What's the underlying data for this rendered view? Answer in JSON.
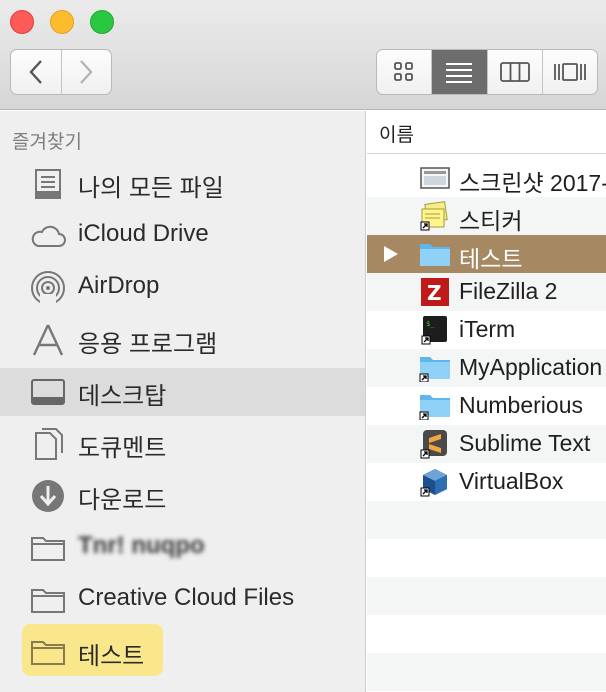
{
  "window": {
    "colors": {
      "close": "#fc5b57",
      "minimize": "#fdbc2e",
      "maximize": "#2ac840",
      "selection": "#a68963",
      "highlight": "#fce57a"
    }
  },
  "toolbar": {
    "back_icon": "chevron-left-icon",
    "forward_icon": "chevron-right-icon",
    "views": [
      "icon-view-icon",
      "list-view-icon",
      "column-view-icon",
      "cover-flow-icon"
    ],
    "active_view": "list-view-icon"
  },
  "sidebar": {
    "heading": "즐겨찾기",
    "items": [
      {
        "label": "나의 모든 파일",
        "icon": "all-files-icon"
      },
      {
        "label": "iCloud Drive",
        "icon": "cloud-icon"
      },
      {
        "label": "AirDrop",
        "icon": "airdrop-icon"
      },
      {
        "label": "응용 프로그램",
        "icon": "applications-icon"
      },
      {
        "label": "데스크탑",
        "icon": "desktop-icon",
        "selected": true
      },
      {
        "label": "도큐멘트",
        "icon": "documents-icon"
      },
      {
        "label": "다운로드",
        "icon": "downloads-icon"
      },
      {
        "label": "Tnr! nuqpo",
        "icon": "folder-icon",
        "blurred": true
      },
      {
        "label": "Creative Cloud Files",
        "icon": "folder-icon"
      },
      {
        "label": "테스트",
        "icon": "folder-icon",
        "highlighted": true
      }
    ]
  },
  "list": {
    "column_header": "이름",
    "rows": [
      {
        "name": "스크린샷 2017-",
        "icon": "screenshot-icon"
      },
      {
        "name": "스티커",
        "icon": "stickies-icon",
        "alias": true
      },
      {
        "name": "테스트",
        "icon": "folder-icon",
        "selected": true,
        "expandable": true
      },
      {
        "name": "FileZilla 2",
        "icon": "filezilla-icon"
      },
      {
        "name": "iTerm",
        "icon": "terminal-icon",
        "alias": true
      },
      {
        "name": "MyApplication",
        "icon": "folder-icon",
        "alias": true
      },
      {
        "name": "Numberious",
        "icon": "folder-icon",
        "alias": true
      },
      {
        "name": "Sublime Text",
        "icon": "sublime-icon",
        "alias": true
      },
      {
        "name": "VirtualBox",
        "icon": "virtualbox-icon",
        "alias": true
      }
    ]
  }
}
